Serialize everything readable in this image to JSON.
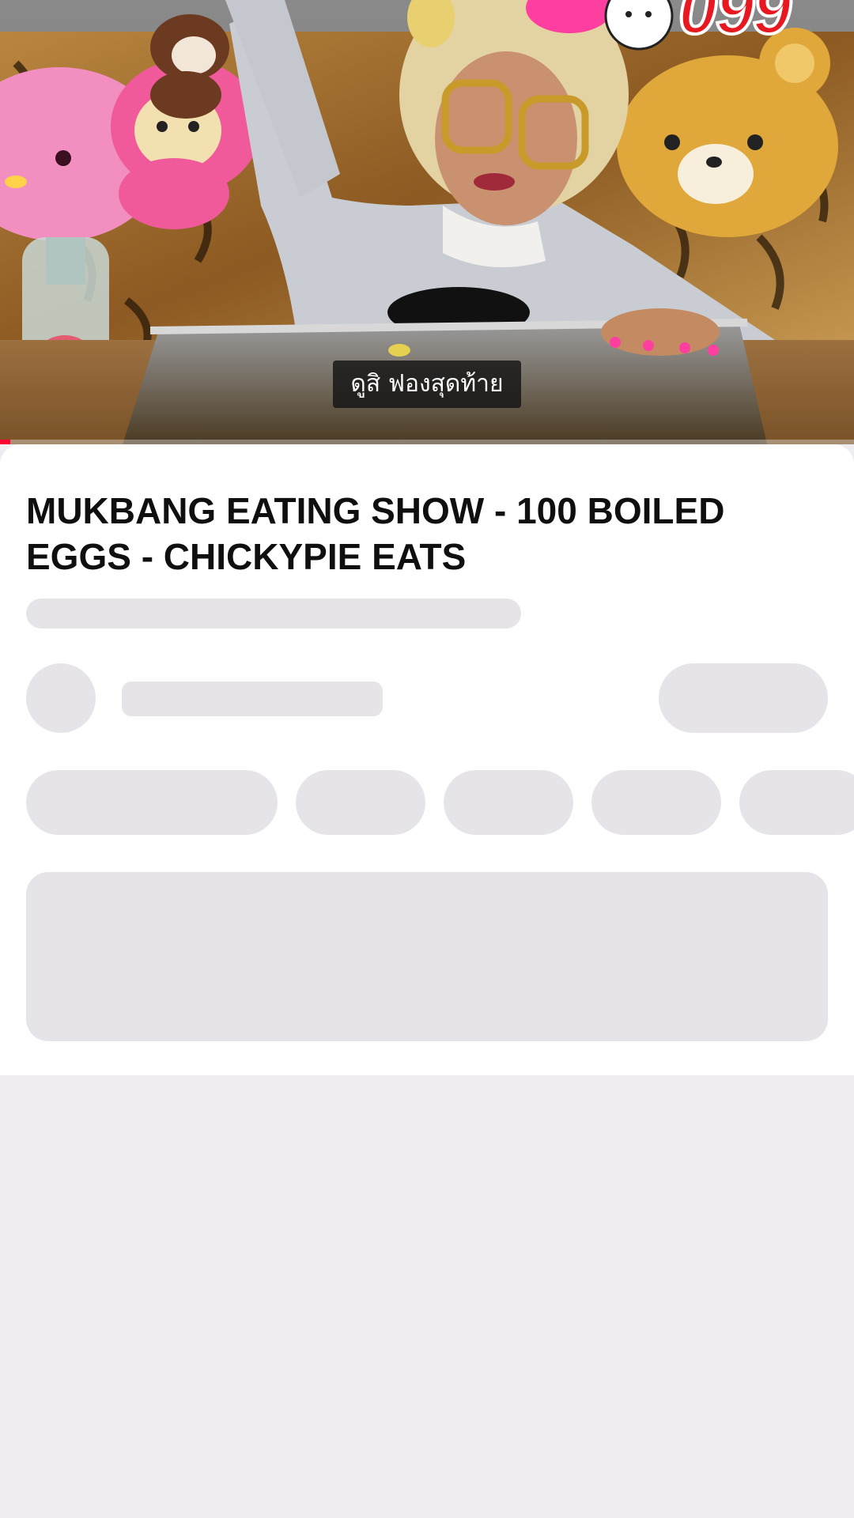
{
  "video": {
    "caption": "ดูสิ ฟองสุดท้าย",
    "overlay_number": "099",
    "progress_fraction": 0.012,
    "progress_color": "#ff0033"
  },
  "details": {
    "title": "MUKBANG EATING SHOW - 100 BOILED EGGS - CHICKYPIE EATS"
  },
  "colors": {
    "skeleton": "#e6e4e8",
    "page_background": "#efedf1",
    "sheet_background": "#ffffff"
  }
}
